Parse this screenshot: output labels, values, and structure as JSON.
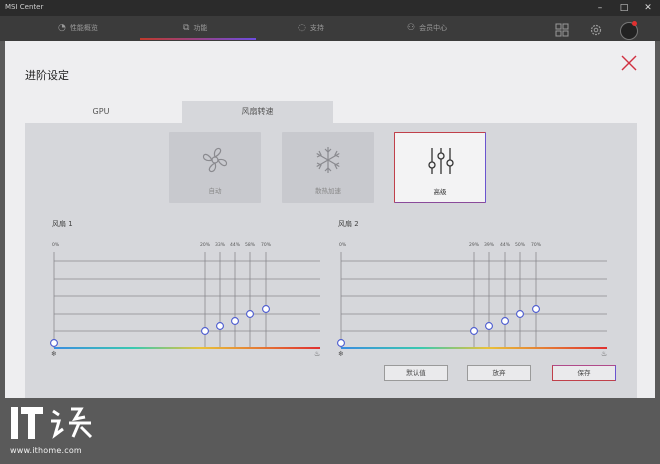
{
  "window": {
    "title": "MSI Center"
  },
  "nav": {
    "tabs": [
      {
        "label": "性能概览",
        "icon": "gauge-icon"
      },
      {
        "label": "功能",
        "icon": "external-link-icon"
      },
      {
        "label": "支持",
        "icon": "chat-icon"
      },
      {
        "label": "会员中心",
        "icon": "person-icon"
      }
    ],
    "active_index": 1
  },
  "modal": {
    "title": "进阶设定",
    "tabs": [
      "GPU",
      "风扇转速"
    ],
    "active_tab_index": 1,
    "modes": [
      {
        "label": "自动",
        "icon": "fan-icon"
      },
      {
        "label": "散热加速",
        "icon": "snowflake-icon"
      },
      {
        "label": "高级",
        "icon": "sliders-icon"
      }
    ],
    "selected_mode_index": 2,
    "fans": [
      {
        "title": "风扇 1",
        "start_label": "0%",
        "point_labels": [
          "20%",
          "33%",
          "44%",
          "58%",
          "70%"
        ],
        "point_levels": [
          0.0,
          0.18,
          0.22,
          0.26,
          0.32,
          0.38
        ],
        "left_icon": "snowflake-icon",
        "right_icon": "flame-icon"
      },
      {
        "title": "风扇 2",
        "start_label": "0%",
        "point_labels": [
          "29%",
          "39%",
          "44%",
          "50%",
          "70%"
        ],
        "point_levels": [
          0.0,
          0.18,
          0.22,
          0.26,
          0.32,
          0.38
        ],
        "left_icon": "snowflake-icon",
        "right_icon": "flame-icon"
      }
    ],
    "buttons": {
      "default": "默认值",
      "discard": "放弃",
      "save": "保存"
    }
  },
  "watermark": {
    "url": "www.ithome.com"
  },
  "colors": {
    "accent_red": "#c0404a",
    "accent_purple": "#6a54d0"
  }
}
